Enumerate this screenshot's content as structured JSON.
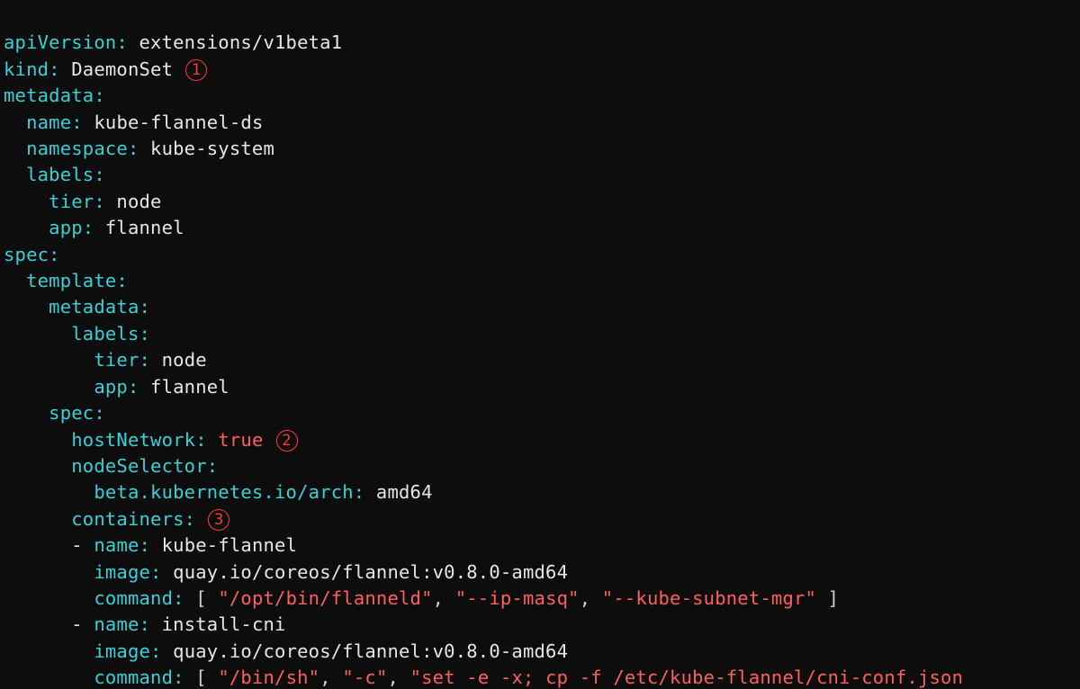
{
  "markers": {
    "m1": "1",
    "m2": "2",
    "m3": "3"
  },
  "lines": {
    "l1": {
      "k": "apiVersion:",
      "v": " extensions/v1beta1"
    },
    "l2": {
      "k": "kind:",
      "v": " DaemonSet"
    },
    "l3": {
      "k": "metadata:"
    },
    "l4": {
      "k": "name:",
      "v": " kube-flannel-ds"
    },
    "l5": {
      "k": "namespace:",
      "v": " kube-system"
    },
    "l6": {
      "k": "labels:"
    },
    "l7": {
      "k": "tier:",
      "v": " node"
    },
    "l8": {
      "k": "app:",
      "v": " flannel"
    },
    "l9": {
      "k": "spec:"
    },
    "l10": {
      "k": "template:"
    },
    "l11": {
      "k": "metadata:"
    },
    "l12": {
      "k": "labels:"
    },
    "l13": {
      "k": "tier:",
      "v": " node"
    },
    "l14": {
      "k": "app:",
      "v": " flannel"
    },
    "l15": {
      "k": "spec:"
    },
    "l16": {
      "k": "hostNetwork:",
      "v": " true"
    },
    "l17": {
      "k": "nodeSelector:"
    },
    "l18": {
      "k": "beta.kubernetes.io/arch:",
      "v": " amd64"
    },
    "l19": {
      "k": "containers:"
    },
    "l20": {
      "dash": "- ",
      "k": "name:",
      "v": " kube-flannel"
    },
    "l21": {
      "k": "image:",
      "v": " quay.io/coreos/flannel:v0.8.0-amd64"
    },
    "l22": {
      "k": "command:",
      "b0": " [ ",
      "s0": "\"/opt/bin/flanneld\"",
      "c0": ", ",
      "s1": "\"--ip-masq\"",
      "c1": ", ",
      "s2": "\"--kube-subnet-mgr\"",
      "b1": " ]"
    },
    "l23": {
      "dash": "- ",
      "k": "name:",
      "v": " install-cni"
    },
    "l24": {
      "k": "image:",
      "v": " quay.io/coreos/flannel:v0.8.0-amd64"
    },
    "l25": {
      "k": "command:",
      "b0": " [ ",
      "s0": "\"/bin/sh\"",
      "c0": ", ",
      "s1": "\"-c\"",
      "c1": ", ",
      "s2": "\"set -e -x; cp -f /etc/kube-flannel/cni-conf.json"
    }
  }
}
